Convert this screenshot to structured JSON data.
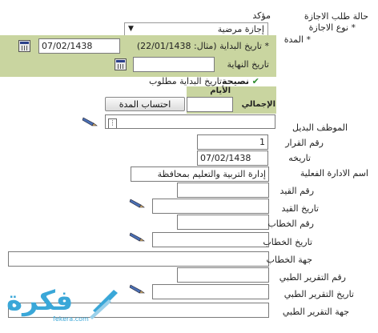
{
  "form": {
    "status_label": "حالة طلب الاجازة",
    "status_value": "مؤكد",
    "leave_type_label": "* نوع الاجازة",
    "leave_type_value": "إجازة مرضية",
    "duration_label": "* المدة",
    "start_date_label": "* تاريخ البداية (مثال: 22/01/1438)",
    "start_date_value": "07/02/1438",
    "end_date_label": "تاريخ النهاية",
    "end_date_value": "",
    "tip_title": "نصيحة",
    "tip_text": "تاريخ البداية مطلوب",
    "days_label": "الأيام",
    "total_label": "الإجمالي",
    "days_value": "",
    "calc_button": "احتساب المدة",
    "substitute_label": "الموظف البديل",
    "decision_no_label": "رقم القرار",
    "decision_no_value": "1",
    "decision_date_label": "تاريخه",
    "decision_date_value": "07/02/1438",
    "admin_label": "اسم الادارة الفعلية",
    "admin_value": "إدارة التربية والتعليم بمحافظة",
    "entry_no_label": "رقم القيد",
    "entry_date_label": "تاريخ القيد",
    "letter_no_label": "رقم الخطاب",
    "letter_date_label": "تاريخ الخطاب",
    "letter_party_label": "جهة الخطاب",
    "report_no_label": "رقم التقرير الطبي",
    "report_date_label": "تاريخ التقرير الطبي",
    "report_party_label": "جهة التقرير الطبي"
  },
  "watermark": {
    "brand": "فكرة",
    "site": "fekera.com"
  },
  "colors": {
    "green_panel": "#c9d5a0",
    "tip_check": "#2e8b2e",
    "watermark": "#3aa7d8"
  }
}
